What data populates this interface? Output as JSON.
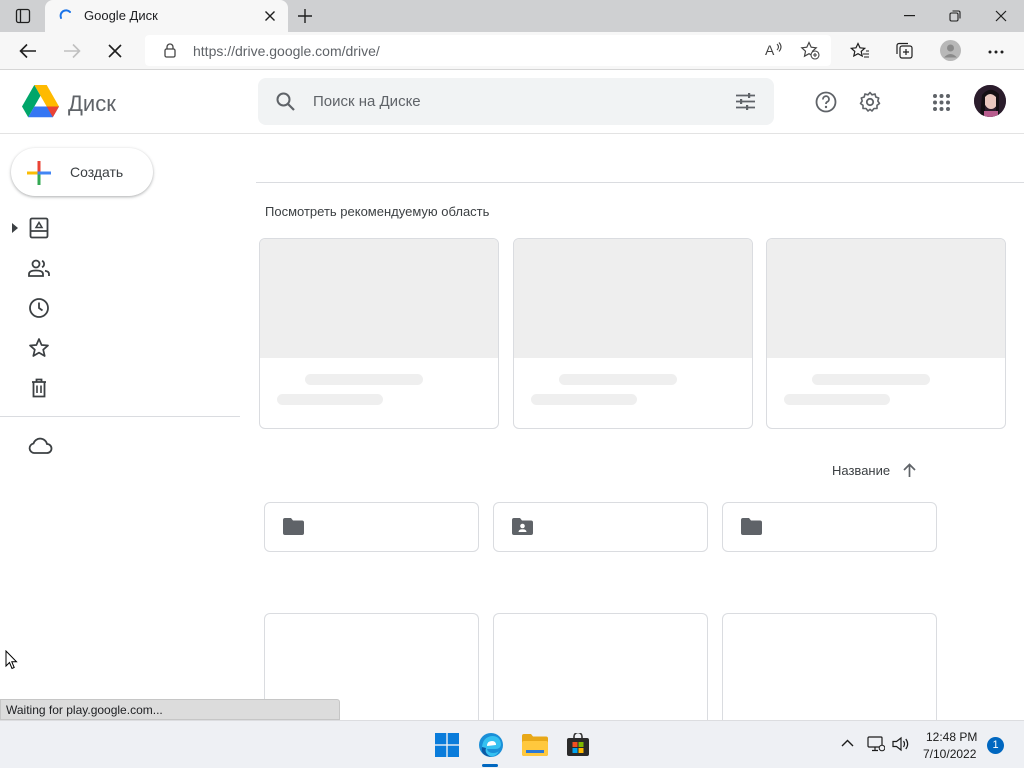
{
  "browser": {
    "tab_title": "Google Диск",
    "url": "https://drive.google.com/drive/",
    "status_text": "Waiting for play.google.com..."
  },
  "header": {
    "app_name": "Диск",
    "search_placeholder": "Поиск на Диске"
  },
  "sidebar": {
    "create_label": "Создать",
    "items": [
      {
        "icon": "my-drive-icon"
      },
      {
        "icon": "shared-with-me-icon"
      },
      {
        "icon": "recent-icon"
      },
      {
        "icon": "starred-icon"
      },
      {
        "icon": "trash-icon"
      },
      {
        "icon": "storage-cloud-icon"
      }
    ]
  },
  "main": {
    "suggested_title": "Посмотреть рекомендуемую область",
    "sort_label": "Название",
    "folders": [
      {
        "icon": "folder-icon"
      },
      {
        "icon": "shared-folder-icon"
      },
      {
        "icon": "folder-icon"
      }
    ]
  },
  "taskbar": {
    "time": "12:48 PM",
    "date": "7/10/2022",
    "notification_count": "1"
  },
  "colors": {
    "accent_blue": "#1a73e8",
    "icon_grey": "#5f6368",
    "taskbar_blue": "#0067c0"
  }
}
